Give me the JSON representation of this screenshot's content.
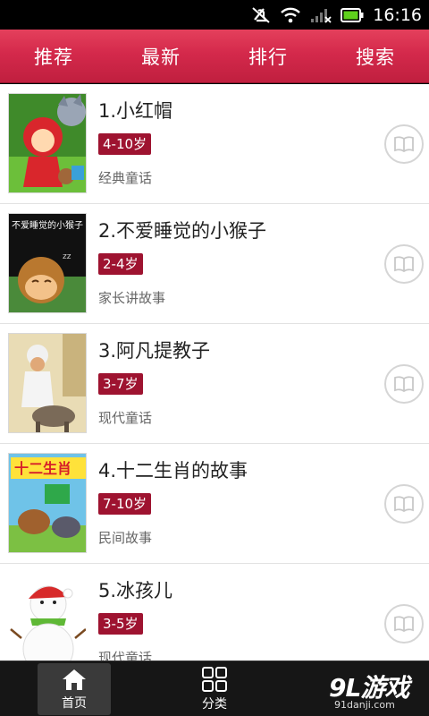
{
  "status_bar": {
    "time": "16:16"
  },
  "tabs": [
    {
      "label": "推荐"
    },
    {
      "label": "最新"
    },
    {
      "label": "排行"
    },
    {
      "label": "搜索"
    }
  ],
  "stories": [
    {
      "title": "1.小红帽",
      "age": "4-10岁",
      "category": "经典童话"
    },
    {
      "title": "2.不爱睡觉的小猴子",
      "age": "2-4岁",
      "category": "家长讲故事",
      "cover_text": "不爱睡觉的小猴子"
    },
    {
      "title": "3.阿凡提教子",
      "age": "3-7岁",
      "category": "现代童话"
    },
    {
      "title": "4.十二生肖的故事",
      "age": "7-10岁",
      "category": "民间故事",
      "cover_text": "十二生肖"
    },
    {
      "title": "5.冰孩儿",
      "age": "3-5岁",
      "category": "现代童话"
    }
  ],
  "bottom_nav": {
    "home_label": "首页",
    "category_label": "分类"
  },
  "watermark": {
    "main": "9L游戏",
    "sub": "91danji.com"
  },
  "colors": {
    "accent": "#d4294b",
    "age_badge": "#9e1330"
  }
}
